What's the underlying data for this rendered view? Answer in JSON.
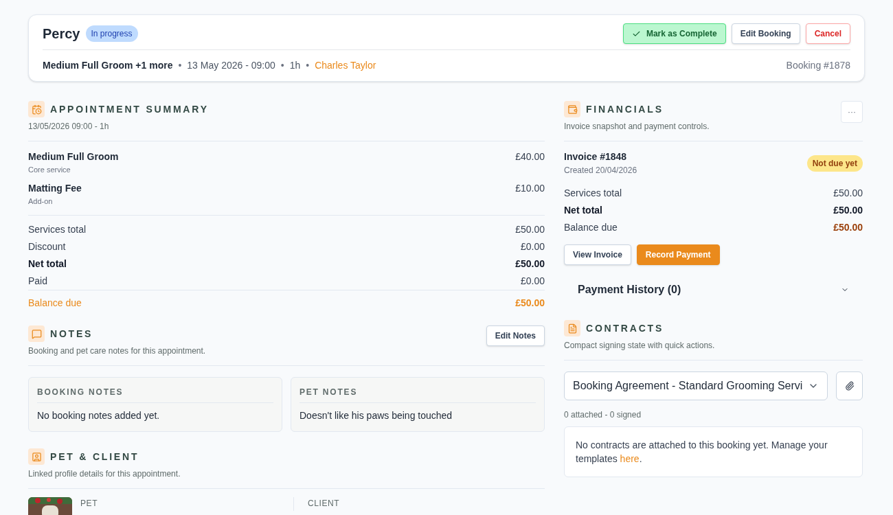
{
  "header": {
    "pet_name": "Percy",
    "status": {
      "label": "In progress",
      "kind": "progress"
    },
    "actions": [
      {
        "label": "Mark as Complete",
        "kind": "complete"
      },
      {
        "label": "Edit Booking",
        "kind": "default"
      },
      {
        "label": "Cancel",
        "kind": "danger"
      }
    ],
    "meta": {
      "services": "Medium Full Groom +1 more",
      "date": "13 May 2026 - 09:00",
      "duration": "1h",
      "staff": "Charles Taylor",
      "separator": "•"
    },
    "booking_number": "Booking #1878"
  },
  "appointment_summary": {
    "title": "APPOINTMENT SUMMARY",
    "subtitle": "13/05/2026 09:00 - 1h",
    "services": [
      {
        "name": "Medium Full Groom",
        "type": "Core service",
        "price": "£40.00"
      },
      {
        "name": "Matting Fee",
        "type": "Add-on",
        "price": "£10.00"
      }
    ],
    "totals": [
      {
        "label": "Services total",
        "value": "£50.00",
        "kind": "plain"
      },
      {
        "label": "Discount",
        "value": "£0.00",
        "kind": "plain"
      },
      {
        "label": "Net total",
        "value": "£50.00",
        "kind": "bold"
      },
      {
        "label": "Paid",
        "value": "£0.00",
        "kind": "plain"
      },
      {
        "label": "Balance due",
        "value": "£50.00",
        "kind": "due"
      }
    ]
  },
  "notes": {
    "title": "NOTES",
    "subtitle": "Booking and pet care notes for this appointment.",
    "edit_button": "Edit Notes",
    "cards": [
      {
        "title": "BOOKING NOTES",
        "text": "No booking notes added yet."
      },
      {
        "title": "PET NOTES",
        "text": "Doesn't like his paws being touched"
      }
    ]
  },
  "pet_client": {
    "title": "PET & CLIENT",
    "subtitle": "Linked profile details for this appointment.",
    "columns": [
      "PET",
      "CLIENT"
    ]
  },
  "financials": {
    "title": "FINANCIALS",
    "subtitle": "Invoice snapshot and payment controls.",
    "menu_button": "···",
    "invoice": {
      "number": "Invoice #1848",
      "created": "Created 20/04/2026",
      "status": "Not due yet"
    },
    "totals": [
      {
        "label": "Services total",
        "value": "£50.00",
        "kind": "plain"
      },
      {
        "label": "Net total",
        "value": "£50.00",
        "kind": "bold"
      },
      {
        "label": "Balance due",
        "value": "£50.00",
        "kind": "due"
      }
    ],
    "buttons": [
      {
        "label": "View Invoice",
        "kind": "default"
      },
      {
        "label": "Record Payment",
        "kind": "primary"
      }
    ],
    "payment_history": {
      "label": "Payment History (0)",
      "expanded": false
    }
  },
  "contracts": {
    "title": "CONTRACTS",
    "subtitle": "Compact signing state with quick actions.",
    "select_value": "Booking Agreement - Standard Grooming Servi",
    "counts": "0 attached - 0 signed",
    "message": "No contracts are attached to this booking yet. Manage your templates",
    "link": "here",
    "suffix": "."
  }
}
